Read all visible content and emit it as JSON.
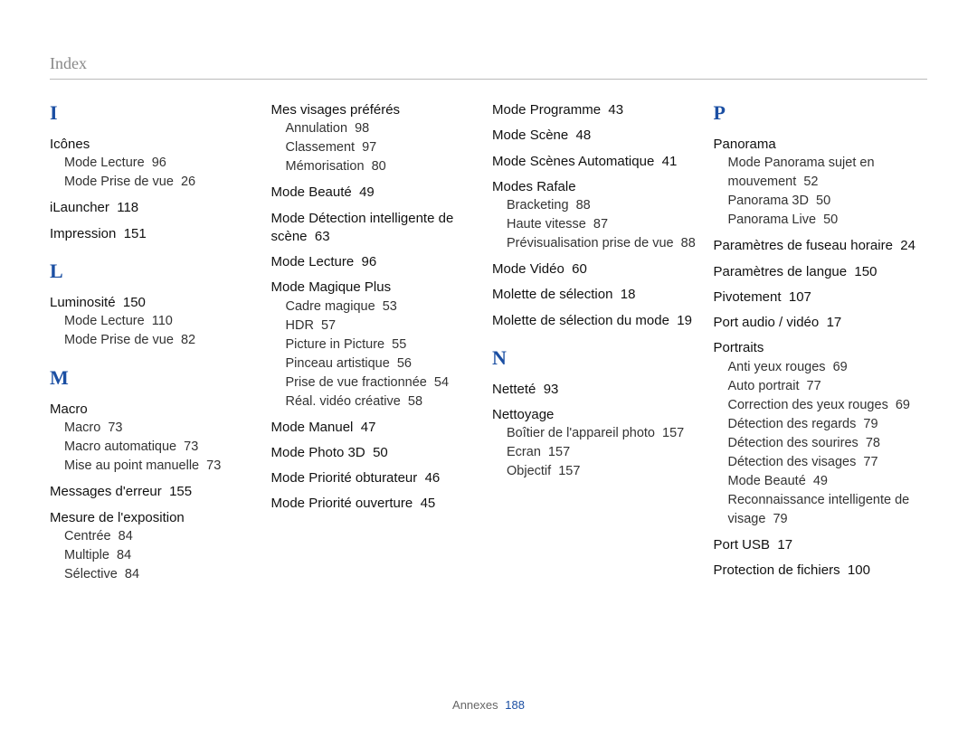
{
  "header": "Index",
  "footer": {
    "label": "Annexes",
    "page_number": "188"
  },
  "columns": [
    [
      {
        "type": "letter",
        "text": "I"
      },
      {
        "type": "entry",
        "main": {
          "label": "Icônes"
        },
        "subs": [
          {
            "label": "Mode Lecture",
            "page": "96"
          },
          {
            "label": "Mode Prise de vue",
            "page": "26"
          }
        ]
      },
      {
        "type": "entry",
        "main": {
          "label": "iLauncher",
          "page": "118"
        }
      },
      {
        "type": "entry",
        "main": {
          "label": "Impression",
          "page": "151"
        }
      },
      {
        "type": "letter",
        "text": "L"
      },
      {
        "type": "entry",
        "main": {
          "label": "Luminosité",
          "page": "150"
        },
        "subs": [
          {
            "label": "Mode Lecture",
            "page": "110"
          },
          {
            "label": "Mode Prise de vue",
            "page": "82"
          }
        ]
      },
      {
        "type": "letter",
        "text": "M"
      },
      {
        "type": "entry",
        "main": {
          "label": "Macro"
        },
        "subs": [
          {
            "label": "Macro",
            "page": "73"
          },
          {
            "label": "Macro automatique",
            "page": "73"
          },
          {
            "label": "Mise au point manuelle",
            "page": "73"
          }
        ]
      },
      {
        "type": "entry",
        "main": {
          "label": "Messages d'erreur",
          "page": "155"
        }
      },
      {
        "type": "entry",
        "main": {
          "label": "Mesure de l'exposition"
        },
        "subs": [
          {
            "label": "Centrée",
            "page": "84"
          },
          {
            "label": "Multiple",
            "page": "84"
          },
          {
            "label": "Sélective",
            "page": "84"
          }
        ]
      }
    ],
    [
      {
        "type": "entry",
        "main": {
          "label": "Mes visages préférés"
        },
        "subs": [
          {
            "label": "Annulation",
            "page": "98"
          },
          {
            "label": "Classement",
            "page": "97"
          },
          {
            "label": "Mémorisation",
            "page": "80"
          }
        ]
      },
      {
        "type": "entry",
        "main": {
          "label": "Mode Beauté",
          "page": "49"
        }
      },
      {
        "type": "entry",
        "main": {
          "label": "Mode Détection intelligente de scène",
          "page": "63"
        }
      },
      {
        "type": "entry",
        "main": {
          "label": "Mode Lecture",
          "page": "96"
        }
      },
      {
        "type": "entry",
        "main": {
          "label": "Mode Magique Plus"
        },
        "subs": [
          {
            "label": "Cadre magique",
            "page": "53"
          },
          {
            "label": "HDR",
            "page": "57"
          },
          {
            "label": "Picture in Picture",
            "page": "55"
          },
          {
            "label": "Pinceau artistique",
            "page": "56"
          },
          {
            "label": "Prise de vue fractionnée",
            "page": "54"
          },
          {
            "label": "Réal. vidéo créative",
            "page": "58"
          }
        ]
      },
      {
        "type": "entry",
        "main": {
          "label": "Mode Manuel",
          "page": "47"
        }
      },
      {
        "type": "entry",
        "main": {
          "label": "Mode Photo 3D",
          "page": "50"
        }
      },
      {
        "type": "entry",
        "main": {
          "label": "Mode Priorité obturateur",
          "page": "46"
        }
      },
      {
        "type": "entry",
        "main": {
          "label": "Mode Priorité ouverture",
          "page": "45"
        }
      }
    ],
    [
      {
        "type": "entry",
        "main": {
          "label": "Mode Programme",
          "page": "43"
        }
      },
      {
        "type": "entry",
        "main": {
          "label": "Mode Scène",
          "page": "48"
        }
      },
      {
        "type": "entry",
        "main": {
          "label": "Mode Scènes Automatique",
          "page": "41"
        }
      },
      {
        "type": "entry",
        "main": {
          "label": "Modes Rafale"
        },
        "subs": [
          {
            "label": "Bracketing",
            "page": "88"
          },
          {
            "label": "Haute vitesse",
            "page": "87"
          },
          {
            "label": "Prévisualisation prise de vue",
            "page": "88"
          }
        ]
      },
      {
        "type": "entry",
        "main": {
          "label": "Mode Vidéo",
          "page": "60"
        }
      },
      {
        "type": "entry",
        "main": {
          "label": "Molette de sélection",
          "page": "18"
        }
      },
      {
        "type": "entry",
        "main": {
          "label": "Molette de sélection du mode",
          "page": "19"
        }
      },
      {
        "type": "letter",
        "text": "N"
      },
      {
        "type": "entry",
        "main": {
          "label": "Netteté",
          "page": "93"
        }
      },
      {
        "type": "entry",
        "main": {
          "label": "Nettoyage"
        },
        "subs": [
          {
            "label": "Boîtier de l'appareil photo",
            "page": "157"
          },
          {
            "label": "Ecran",
            "page": "157"
          },
          {
            "label": "Objectif",
            "page": "157"
          }
        ]
      }
    ],
    [
      {
        "type": "letter",
        "text": "P"
      },
      {
        "type": "entry",
        "main": {
          "label": "Panorama"
        },
        "subs": [
          {
            "label": "Mode Panorama sujet en mouvement",
            "page": "52"
          },
          {
            "label": "Panorama 3D",
            "page": "50"
          },
          {
            "label": "Panorama Live",
            "page": "50"
          }
        ]
      },
      {
        "type": "entry",
        "main": {
          "label": "Paramètres de fuseau horaire",
          "page": "24"
        }
      },
      {
        "type": "entry",
        "main": {
          "label": "Paramètres de langue",
          "page": "150"
        }
      },
      {
        "type": "entry",
        "main": {
          "label": "Pivotement",
          "page": "107"
        }
      },
      {
        "type": "entry",
        "main": {
          "label": "Port audio / vidéo",
          "page": "17"
        }
      },
      {
        "type": "entry",
        "main": {
          "label": "Portraits"
        },
        "subs": [
          {
            "label": "Anti yeux rouges",
            "page": "69"
          },
          {
            "label": "Auto portrait",
            "page": "77"
          },
          {
            "label": "Correction des yeux rouges",
            "page": "69"
          },
          {
            "label": "Détection des regards",
            "page": "79"
          },
          {
            "label": "Détection des sourires",
            "page": "78"
          },
          {
            "label": "Détection des visages",
            "page": "77"
          },
          {
            "label": "Mode Beauté",
            "page": "49"
          },
          {
            "label": "Reconnaissance intelligente de visage",
            "page": "79"
          }
        ]
      },
      {
        "type": "entry",
        "main": {
          "label": "Port USB",
          "page": "17"
        }
      },
      {
        "type": "entry",
        "main": {
          "label": "Protection de fichiers",
          "page": "100"
        }
      }
    ]
  ]
}
